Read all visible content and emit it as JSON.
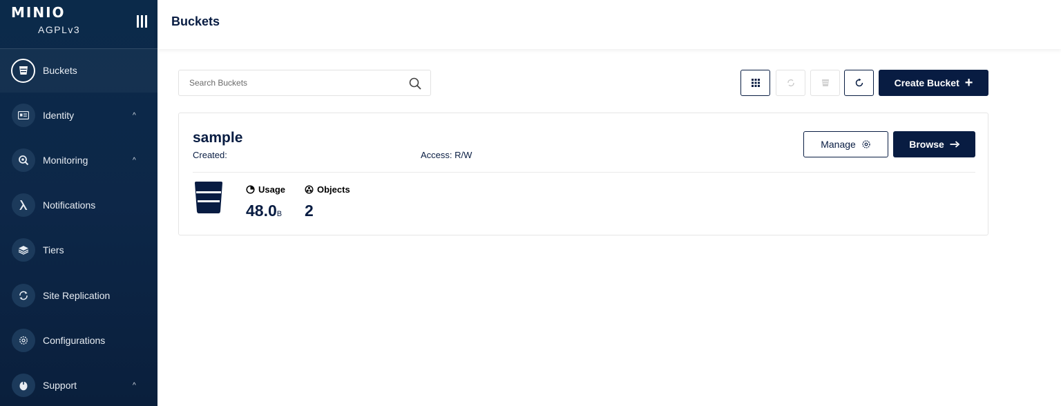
{
  "brand": {
    "logo": "MINIO",
    "license": "AGPLv3"
  },
  "sidebar": {
    "items": [
      {
        "label": "Buckets",
        "icon": "bucket-icon",
        "active": true,
        "expandable": false
      },
      {
        "label": "Identity",
        "icon": "identity-card-icon",
        "active": false,
        "expandable": true
      },
      {
        "label": "Monitoring",
        "icon": "monitoring-magnifier-icon",
        "active": false,
        "expandable": true
      },
      {
        "label": "Notifications",
        "icon": "lambda-icon",
        "active": false,
        "expandable": false
      },
      {
        "label": "Tiers",
        "icon": "layers-icon",
        "active": false,
        "expandable": false
      },
      {
        "label": "Site Replication",
        "icon": "replication-icon",
        "active": false,
        "expandable": false
      },
      {
        "label": "Configurations",
        "icon": "gear-icon",
        "active": false,
        "expandable": false
      },
      {
        "label": "Support",
        "icon": "support-icon",
        "active": false,
        "expandable": true
      }
    ],
    "chevron": "^"
  },
  "header": {
    "title": "Buckets"
  },
  "toolbar": {
    "search_placeholder": "Search Buckets",
    "create_label": "Create Bucket",
    "create_icon": "+"
  },
  "bucket": {
    "name": "sample",
    "created_label": "Created:",
    "access_label": "Access: R/W",
    "manage_label": "Manage",
    "browse_label": "Browse",
    "usage_label": "Usage",
    "usage_value": "48.0",
    "usage_unit": "B",
    "objects_label": "Objects",
    "objects_value": "2"
  },
  "colors": {
    "sidebar": "#0d2748",
    "primary": "#081c42",
    "border": "#e2e2e2"
  }
}
